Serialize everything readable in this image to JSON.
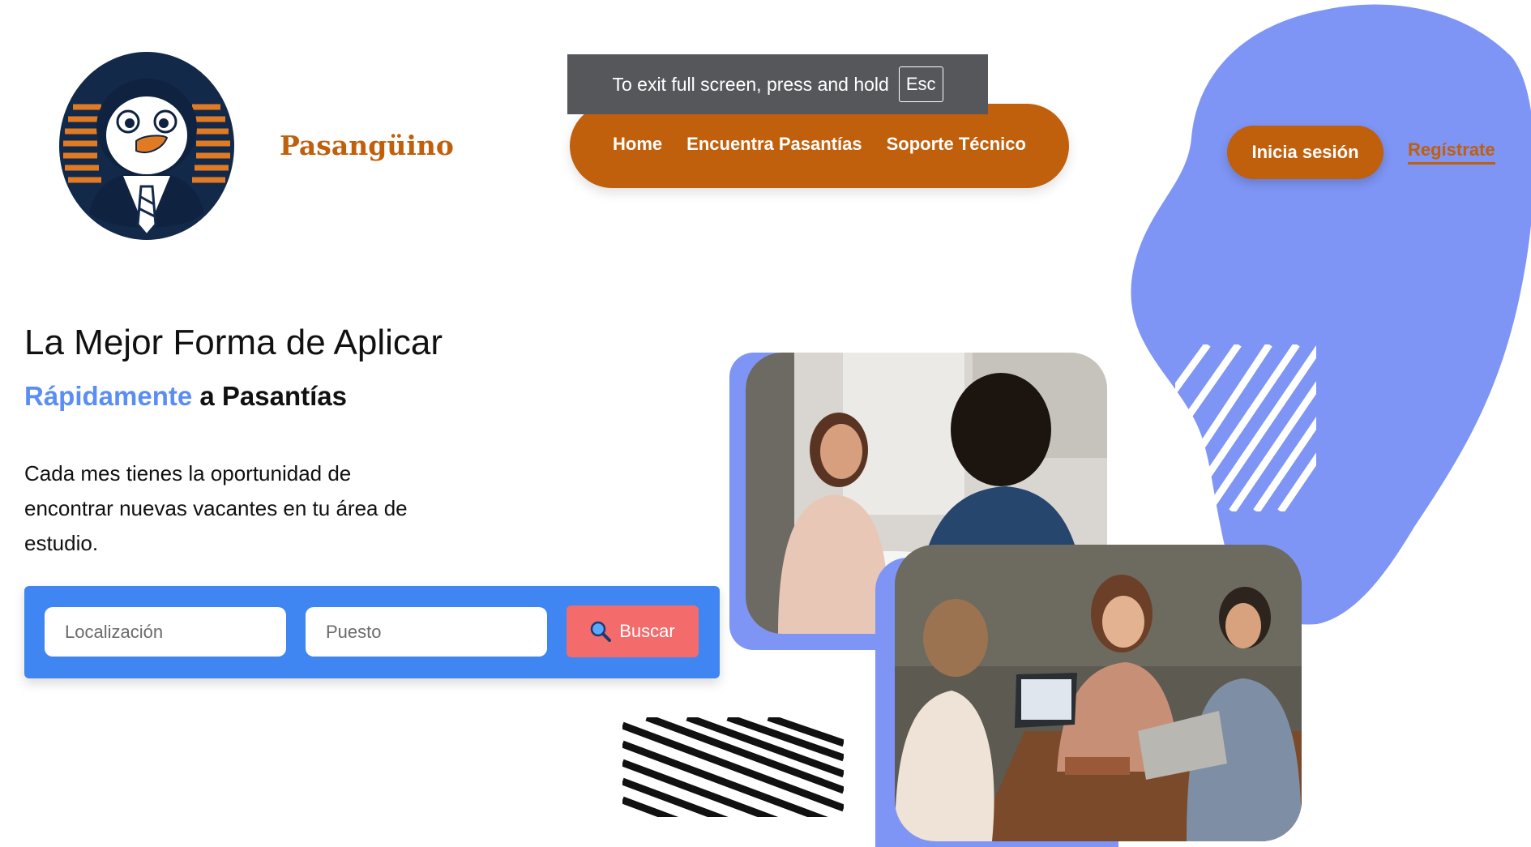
{
  "brand": {
    "name": "Pasangüino",
    "colors": {
      "primary": "#c05f0c",
      "accent": "#5b8ef5",
      "panel": "#3f86f2",
      "search_button": "#f36b6b",
      "blob": "#7e95f5"
    }
  },
  "fullscreen_notice": {
    "text": "To exit full screen, press and hold",
    "key": "Esc"
  },
  "nav": {
    "items": [
      {
        "label": "Home"
      },
      {
        "label": "Encuentra Pasantías"
      },
      {
        "label": "Soporte Técnico"
      }
    ]
  },
  "auth": {
    "login_label": "Inicia sesión",
    "register_label": "Regístrate"
  },
  "hero": {
    "title": "La Mejor Forma de Aplicar",
    "subtitle_accent": "Rápidamente",
    "subtitle_rest": " a Pasantías",
    "description": "Cada mes tienes la oportunidad de encontrar nuevas vacantes en tu área de estudio."
  },
  "search": {
    "location_placeholder": "Localización",
    "location_value": "",
    "position_placeholder": "Puesto",
    "position_value": "",
    "button_icon": "magnifier-icon",
    "button_label": "Buscar"
  },
  "images": {
    "photo1_icon": "interview-photo",
    "photo2_icon": "team-meeting-photo"
  }
}
